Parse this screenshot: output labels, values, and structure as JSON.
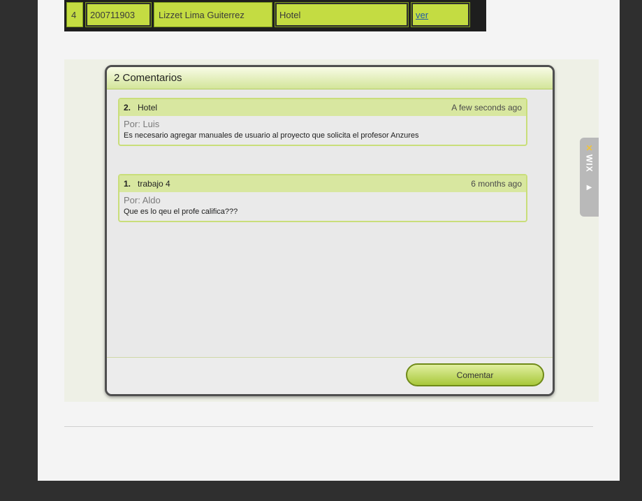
{
  "table_row": {
    "num": "4",
    "id": "200711903",
    "name": "Lizzet Lima Guiterrez",
    "project": "Hotel",
    "link": "ver"
  },
  "comments_box": {
    "title": "2 Comentarios",
    "comments": [
      {
        "number": "2.",
        "title": "Hotel",
        "time": "A few seconds ago",
        "author": "Por: Luis",
        "text": "Es necesario agregar manuales de usuario al proyecto que solicita el profesor Anzures"
      },
      {
        "number": "1.",
        "title": "trabajo 4",
        "time": "6 months ago",
        "author": "Por: Aldo",
        "text": "Que es lo qeu el profe califica???"
      }
    ],
    "button_label": "Comentar"
  },
  "wix_tab": {
    "label": "WIX",
    "icon": "wix-x-icon",
    "arrow_icon": "play-arrow-icon"
  },
  "colors": {
    "accent": "#c4dc42",
    "frame": "#4f4f4f",
    "page_bg": "#2f2f2f"
  }
}
